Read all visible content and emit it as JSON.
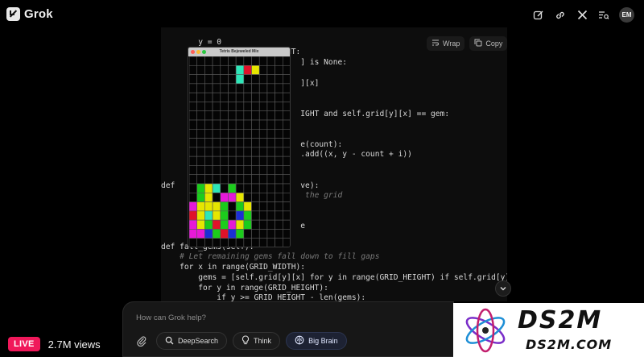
{
  "app": {
    "name": "Grok",
    "avatar_initials": "EM"
  },
  "toolbar": {
    "icons": [
      "edit-icon",
      "link-icon",
      "x-logo-icon",
      "search-list-icon"
    ]
  },
  "code_block": {
    "wrap_label": "Wrap",
    "copy_label": "Copy",
    "lines": [
      "          ",
      "        y = 0",
      "        while y < GRID_HEIGHT:",
      "                              ] is None:",
      "",
      "                              ][x]",
      "",
      "",
      "                              IGHT and self.grid[y][x] == gem:",
      "",
      "",
      "                              e(count):",
      "                              .add((x, y - count + i))",
      "",
      "",
      "def                           ve):",
      "                               the grid",
      "",
      "",
      "                              e",
      "",
      "def fall_gems(self):",
      "    # Let remaining gems fall down to fill gaps",
      "    for x in range(GRID_WIDTH):",
      "        gems = [self.grid[y][x] for y in range(GRID_HEIGHT) if self.grid[y][x]",
      "        for y in range(GRID_HEIGHT):",
      "            if y >= GRID_HEIGHT - len(gems):"
    ]
  },
  "game": {
    "title": "Tetris Bejeweled Mix",
    "dot_colors": [
      "#ff5f57",
      "#febc2e",
      "#28c840"
    ],
    "palette": {
      "R": "#e0122a",
      "Y": "#e6e600",
      "G": "#1ccc1c",
      "C": "#2ee6b8",
      "M": "#e619d8",
      "B": "#1b2fd6",
      "_": ""
    },
    "rows": [
      "_____________",
      "______CRY____",
      "______C______",
      "_____________",
      "_____________",
      "_____________",
      "_____________",
      "_____________",
      "_____________",
      "_____________",
      "_____________",
      "_____________",
      "_____________",
      "_____________",
      "_GYC_G_______",
      "_GY_MMY______",
      "MYYYG_GY_____",
      "RYCYG_BG_____",
      "MYGRGMYG_____",
      "MMBGRBG______",
      "_____________"
    ]
  },
  "composer": {
    "placeholder": "How can Grok help?",
    "deepsearch_label": "DeepSearch",
    "think_label": "Think",
    "bigbrain_label": "Big Brain"
  },
  "stream": {
    "live_label": "LIVE",
    "views": "2.7M views"
  },
  "watermark": {
    "title": "DS2M",
    "subtitle": "DS2M.COM"
  }
}
